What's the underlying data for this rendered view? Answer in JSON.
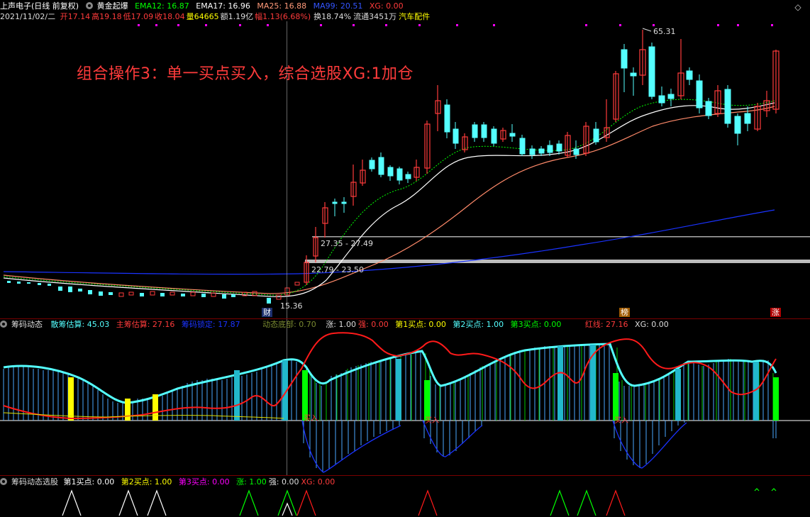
{
  "header1": {
    "stock_name": "上声电子",
    "mode": "(日线 前复权)",
    "indicator_name": "黄金起爆",
    "ema12": "EMA12: 16.87",
    "ema17": "EMA17: 16.96",
    "ma25": "MA25: 16.88",
    "ma99": "MA99: 20.51",
    "xg": "XG: 0.00"
  },
  "header2": {
    "date": "2021/11/02/二",
    "open": "开17.14",
    "high": "高19.18",
    "low": "低17.09",
    "close": "收18.04",
    "volume": "量64665",
    "amount": "额1.19亿",
    "change": "幅1.13(6.68%)",
    "turnover": "换18.74%",
    "float": "流通3451万",
    "sector": "汽车配件"
  },
  "annotation": "组合操作3：单一买点买入，综合选股XG:1加仓",
  "price_labels": {
    "high_label": "65.31",
    "range1": "27.35 - 27.49",
    "range2": "22.79 - 23.50",
    "low_label": "15.36"
  },
  "markers": {
    "cai": "财",
    "bang": "榜",
    "zhang": "涨"
  },
  "panel2": {
    "name": "筹码动态",
    "sanchou": "散筹估算: 45.03",
    "zhuchou": "主筹估算: 27.16",
    "suoding": "筹码锁定: 17.87",
    "dibu": "动态底部: 0.70",
    "zhang": "涨: 1.00",
    "qiang": "强: 0.00",
    "buy1": "第1买点: 0.00",
    "buy2": "第2买点: 1.00",
    "buy3": "第3买点: 0.00",
    "hongxian": "红线: 27.16",
    "xg": "XG: 0.00",
    "mairu": "买入"
  },
  "panel3": {
    "name": "筹码动态选股",
    "buy1": "第1买点: 0.00",
    "buy2": "第2买点: 1.00",
    "buy3": "第3买点: 0.00",
    "zhang": "涨: 1.00",
    "qiang": "强: 0.00",
    "xg": "XG: 0.00"
  },
  "colors": {
    "up": "#ff3b3b",
    "down": "#54ffff",
    "ema_white": "#ffffff",
    "ema_green": "#00ff00",
    "ma25": "#ff7a5a",
    "ma99": "#1a33ff",
    "yellow": "#ffff00",
    "magenta": "#ff00ff"
  }
}
